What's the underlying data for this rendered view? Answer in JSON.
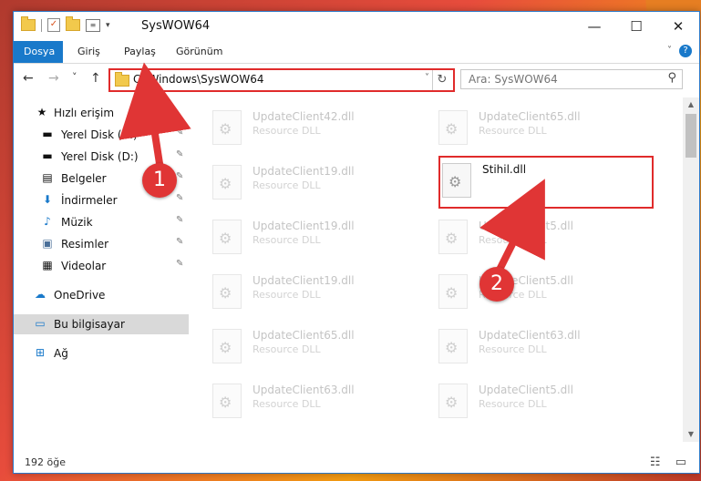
{
  "window": {
    "title": "SysWOW64",
    "controls": {
      "minimize": "—",
      "maximize": "☐",
      "close": "✕"
    }
  },
  "ribbon": {
    "tabs": [
      "Dosya",
      "Giriş",
      "Paylaş",
      "Görünüm"
    ],
    "help": "?"
  },
  "navigation": {
    "back": "←",
    "forward": "→",
    "recent": "˅",
    "up": "↑",
    "address": "C:\\Windows\\SysWOW64",
    "search_placeholder": "Ara: SysWOW64"
  },
  "sidebar": {
    "items": [
      {
        "label": "Hızlı erişim",
        "icon": "star-icon",
        "glyph": "★",
        "color": "#1979ca"
      },
      {
        "label": "Yerel Disk (C:)",
        "icon": "drive-icon",
        "glyph": "▬",
        "color": "#555555"
      },
      {
        "label": "Yerel Disk (D:)",
        "icon": "drive-icon",
        "glyph": "▬",
        "color": "#555555"
      },
      {
        "label": "Belgeler",
        "icon": "documents-icon",
        "glyph": "▤",
        "color": "#555555"
      },
      {
        "label": "İndirmeler",
        "icon": "download-icon",
        "glyph": "⬇",
        "color": "#1979ca"
      },
      {
        "label": "Müzik",
        "icon": "music-icon",
        "glyph": "♪",
        "color": "#1979ca"
      },
      {
        "label": "Resimler",
        "icon": "pictures-icon",
        "glyph": "▣",
        "color": "#4a6f99"
      },
      {
        "label": "Videolar",
        "icon": "video-icon",
        "glyph": "▦",
        "color": "#333333"
      },
      {
        "label": "OneDrive",
        "icon": "cloud-icon",
        "glyph": "☁",
        "color": "#1979ca"
      },
      {
        "label": "Bu bilgisayar",
        "icon": "computer-icon",
        "glyph": "▭",
        "color": "#1979ca"
      },
      {
        "label": "Ağ",
        "icon": "network-icon",
        "glyph": "⊞",
        "color": "#1979ca"
      }
    ],
    "pin_glyph": "📌"
  },
  "files": [
    {
      "name": "UpdateClient42.dll",
      "type": "Resource DLL"
    },
    {
      "name": "UpdateClient65.dll",
      "type": "Resource DLL"
    },
    {
      "name": "UpdateClient19.dll",
      "type": "Resource DLL"
    },
    {
      "name": "Stihil.dll",
      "type": ""
    },
    {
      "name": "UpdateClient19.dll",
      "type": "Resource DLL"
    },
    {
      "name": "UpdateClient5.dll",
      "type": "Resource DLL"
    },
    {
      "name": "UpdateClient19.dll",
      "type": "Resource DLL"
    },
    {
      "name": "UpdateClient5.dll",
      "type": "Resource DLL"
    },
    {
      "name": "UpdateClient65.dll",
      "type": "Resource DLL"
    },
    {
      "name": "UpdateClient63.dll",
      "type": "Resource DLL"
    },
    {
      "name": "UpdateClient63.dll",
      "type": "Resource DLL"
    },
    {
      "name": "UpdateClient5.dll",
      "type": "Resource DLL"
    }
  ],
  "status": {
    "count": "192 öğe",
    "view_icons": "☷ ▭"
  },
  "annotations": {
    "badge1": "1",
    "badge2": "2",
    "accent": "#e03535"
  }
}
